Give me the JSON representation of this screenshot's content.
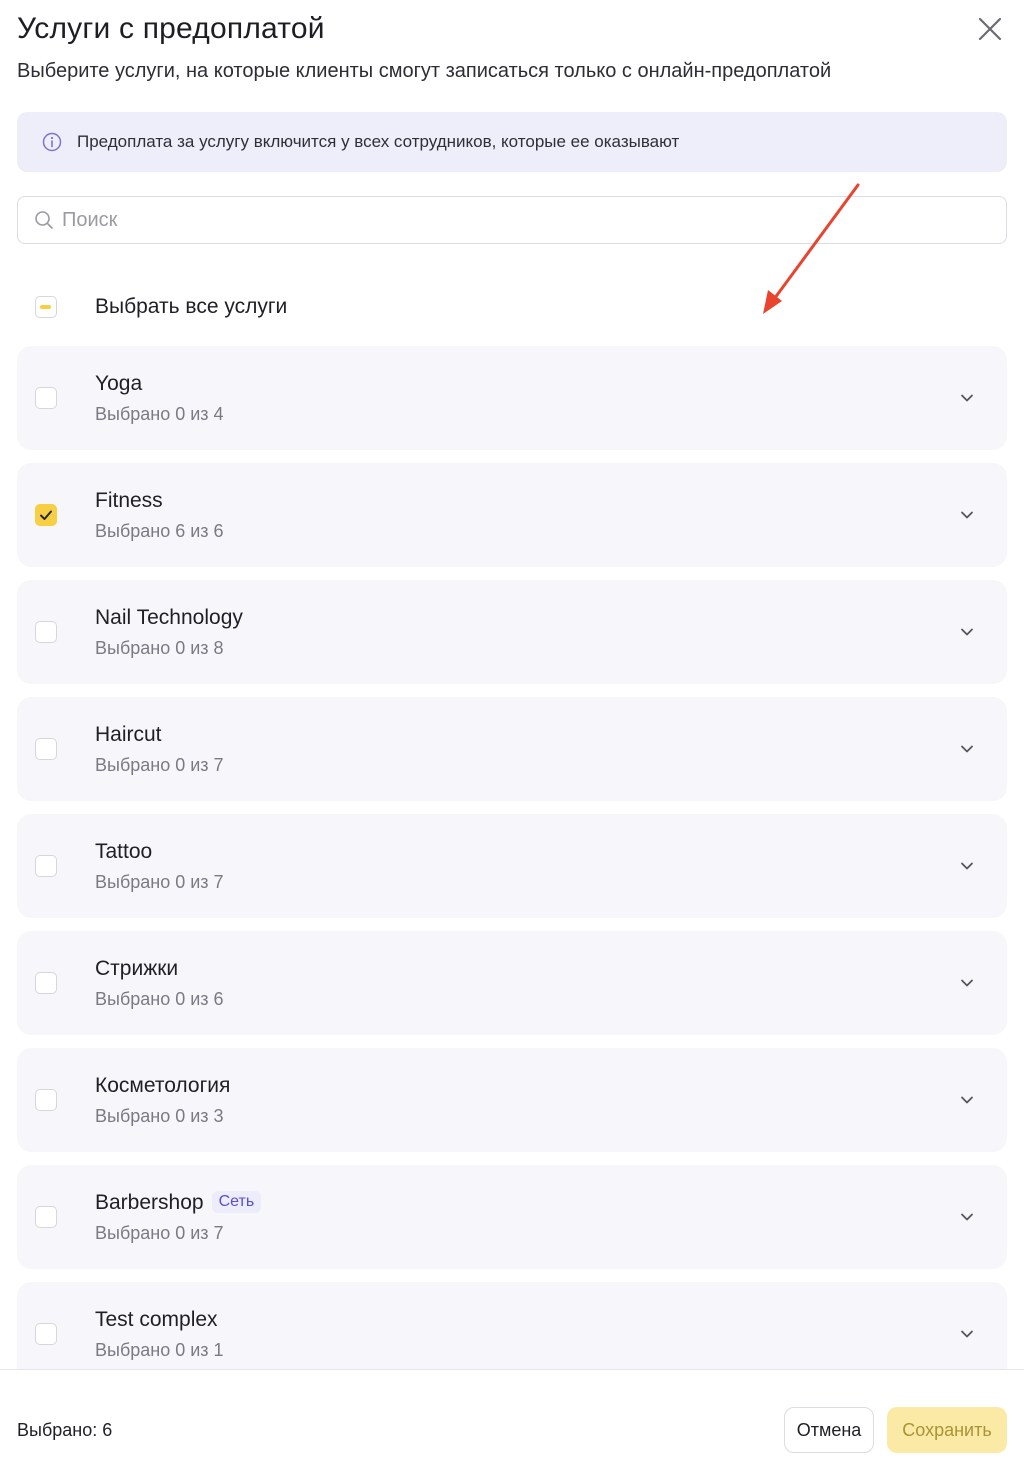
{
  "dialog": {
    "title": "Услуги с предоплатой",
    "subtitle": "Выберите услуги, на которые клиенты смогут записаться только с онлайн-предоплатой",
    "close_icon": "close-icon"
  },
  "info": {
    "icon": "info-icon",
    "text": "Предоплата за услугу включится у всех сотрудников, которые ее оказывают"
  },
  "search": {
    "placeholder": "Поиск",
    "value": ""
  },
  "select_all": {
    "label": "Выбрать все услуги",
    "state": "partial"
  },
  "categories": [
    {
      "name": "Yoga",
      "count": "Выбрано 0 из 4",
      "checked": false
    },
    {
      "name": "Fitness",
      "count": "Выбрано 6 из 6",
      "checked": true
    },
    {
      "name": "Nail Technology",
      "count": "Выбрано 0 из 8",
      "checked": false
    },
    {
      "name": "Haircut",
      "count": "Выбрано 0 из 7",
      "checked": false
    },
    {
      "name": "Tattoo",
      "count": "Выбрано 0 из 7",
      "checked": false
    },
    {
      "name": "Стрижки",
      "count": "Выбрано 0 из 6",
      "checked": false
    },
    {
      "name": "Косметология",
      "count": "Выбрано 0 из 3",
      "checked": false
    },
    {
      "name": "Barbershop",
      "badge": "Сеть",
      "count": "Выбрано 0 из 7",
      "checked": false
    },
    {
      "name": "Test complex",
      "count": "Выбрано 0 из 1",
      "checked": false
    }
  ],
  "footer": {
    "selected": "Выбрано: 6",
    "cancel_label": "Отмена",
    "save_label": "Сохранить"
  },
  "colors": {
    "accent": "#f6cf45",
    "info_bg": "#eeeefb",
    "badge_text": "#5a4fcf",
    "annotation_arrow": "#e8442e"
  }
}
